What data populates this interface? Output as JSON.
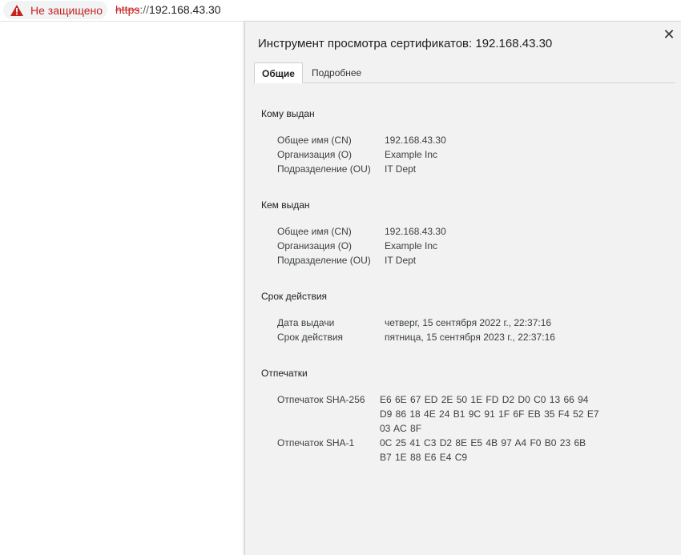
{
  "omnibox": {
    "security_label": "Не защищено",
    "url_scheme": "https",
    "url_sep": "://",
    "url_host": "192.168.43.30"
  },
  "viewer": {
    "title": "Инструмент просмотра сертификатов: 192.168.43.30",
    "close": "✕",
    "tabs": [
      {
        "label": "Общие"
      },
      {
        "label": "Подробнее"
      }
    ],
    "issued_to": {
      "heading": "Кому выдан",
      "rows": [
        {
          "label": "Общее имя (CN)",
          "value": "192.168.43.30"
        },
        {
          "label": "Организация (O)",
          "value": "Example Inc"
        },
        {
          "label": "Подразделение (OU)",
          "value": "IT Dept"
        }
      ]
    },
    "issued_by": {
      "heading": "Кем выдан",
      "rows": [
        {
          "label": "Общее имя (CN)",
          "value": "192.168.43.30"
        },
        {
          "label": "Организация (O)",
          "value": "Example Inc"
        },
        {
          "label": "Подразделение (OU)",
          "value": "IT Dept"
        }
      ]
    },
    "validity": {
      "heading": "Срок действия",
      "rows": [
        {
          "label": "Дата выдачи",
          "value": "четверг, 15 сентября 2022 г., 22:37:16"
        },
        {
          "label": "Срок действия",
          "value": "пятница, 15 сентября 2023 г., 22:37:16"
        }
      ]
    },
    "fingerprints": {
      "heading": "Отпечатки",
      "rows": [
        {
          "label": "Отпечаток SHA-256",
          "value": "E6 6E 67 ED 2E 50 1E FD D2 D0 C0 13 66 94 D9 86 18 4E 24 B1 9C 91 1F 6F EB 35 F4 52 E7 03 AC 8F"
        },
        {
          "label": "Отпечаток SHA-1",
          "value": "0C 25 41 C3 D2 8E E5 4B 97 A4 F0 B0 23 6B B7 1E 88 E6 E4 C9"
        }
      ]
    }
  },
  "colors": {
    "warning_red": "#c5221f",
    "panel_bg": "#f2f2f2"
  }
}
